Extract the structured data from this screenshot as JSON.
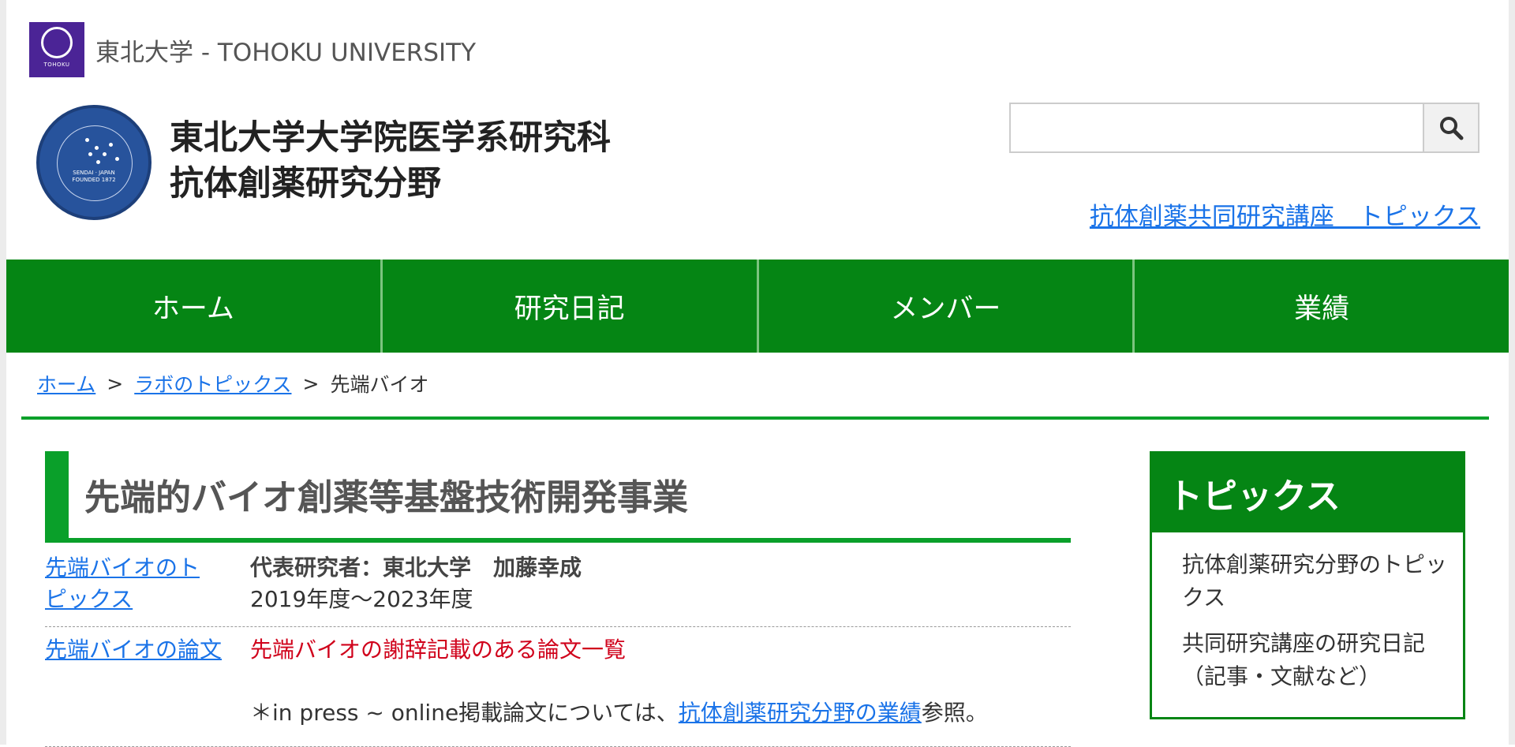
{
  "top_bar": {
    "university_name": "東北大学 - TOHOKU UNIVERSITY",
    "logo_text": "TOHOKU"
  },
  "header": {
    "title_line1": "東北大学大学院医学系研究科",
    "title_line2": "抗体創薬研究分野",
    "emblem_text": "SENDAI · JAPAN FOUNDED 1872",
    "search": {
      "value": "",
      "placeholder": ""
    },
    "topics_link": "抗体創薬共同研究講座　トピックス"
  },
  "nav": {
    "items": [
      "ホーム",
      "研究日記",
      "メンバー",
      "業績"
    ]
  },
  "breadcrumb": {
    "home": "ホーム",
    "topics": "ラボのトピックス",
    "current": "先端バイオ",
    "separator": ">"
  },
  "main": {
    "heading": "先端的バイオ創薬等基盤技術開発事業",
    "rows": [
      {
        "label": "先端バイオのトピックス",
        "lines": [
          "代表研究者：東北大学　加藤幸成",
          "2019年度〜2023年度"
        ]
      },
      {
        "label": "先端バイオの論文",
        "red_link": "先端バイオの謝辞記載のある論文一覧",
        "note_prefix": "＊in press ~ online掲載論文については、",
        "note_link": "抗体創薬研究分野の業績",
        "note_suffix": "参照。"
      }
    ]
  },
  "sidebar": {
    "title": "トピックス",
    "items": [
      "抗体創薬研究分野のトピックス",
      "共同研究講座の研究日記（記事・文献など）"
    ]
  },
  "colors": {
    "nav_green": "#058514",
    "accent_green": "#0aa02a",
    "link_blue": "#1a73e8",
    "alert_red": "#d0021b",
    "uni_purple": "#4b2496"
  }
}
